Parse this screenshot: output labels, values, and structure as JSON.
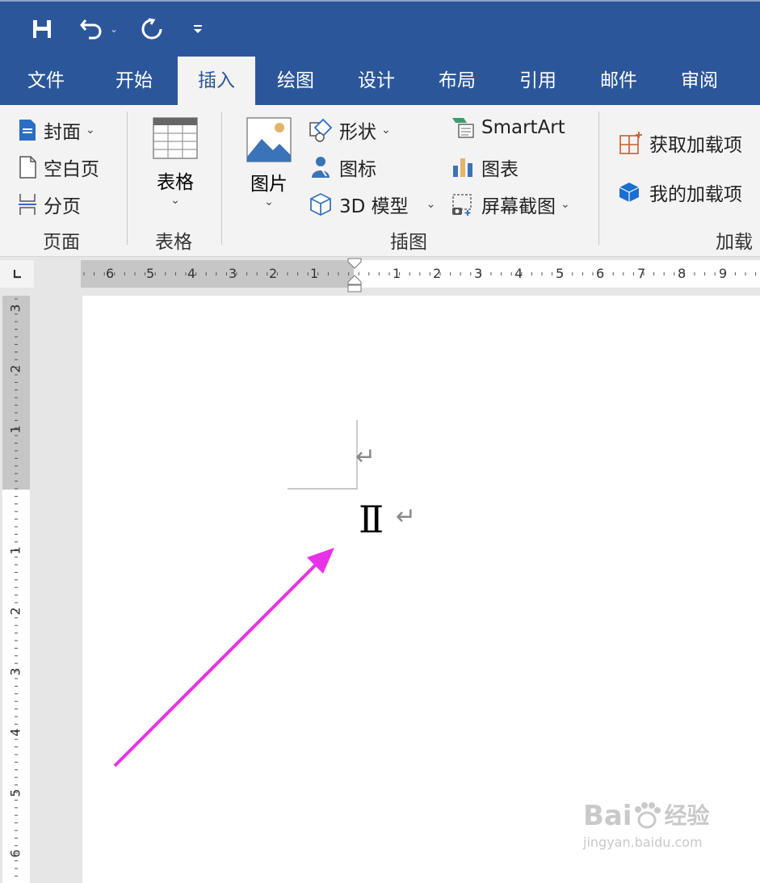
{
  "quick_access": {
    "save": "save-icon",
    "undo": "undo-icon",
    "redo": "redo-icon",
    "customize": "customize-icon"
  },
  "tabs": [
    "文件",
    "开始",
    "插入",
    "绘图",
    "设计",
    "布局",
    "引用",
    "邮件",
    "审阅"
  ],
  "active_tab": "插入",
  "ribbon": {
    "pages": {
      "cover": "封面",
      "blank": "空白页",
      "break": "分页",
      "label": "页面"
    },
    "table": {
      "button": "表格",
      "label": "表格"
    },
    "illustrations": {
      "picture": "图片",
      "shapes": "形状",
      "icons": "图标",
      "model": "3D 模型",
      "smartart": "SmartArt",
      "chart": "图表",
      "screenshot": "屏幕截图",
      "label": "插图"
    },
    "addins": {
      "get": "获取加载项",
      "my": "我的加载项",
      "label": "加载项"
    }
  },
  "ruler": {
    "h_left": [
      "6",
      "5",
      "4",
      "3",
      "2",
      "1"
    ],
    "h_right": [
      "1",
      "2",
      "3",
      "4",
      "5",
      "6",
      "7",
      "8",
      "9"
    ],
    "v_top": [
      "3",
      "2",
      "1"
    ],
    "v_bottom": [
      "1",
      "2",
      "3",
      "4",
      "5",
      "6"
    ]
  },
  "document": {
    "symbol": "Ⅱ",
    "para_mark": "↵"
  },
  "watermark": {
    "brand": "Bai",
    "suffix": "经验",
    "url": "jingyan.baidu.com"
  },
  "colors": {
    "accent": "#2b579a",
    "arrow": "#e832e8"
  }
}
